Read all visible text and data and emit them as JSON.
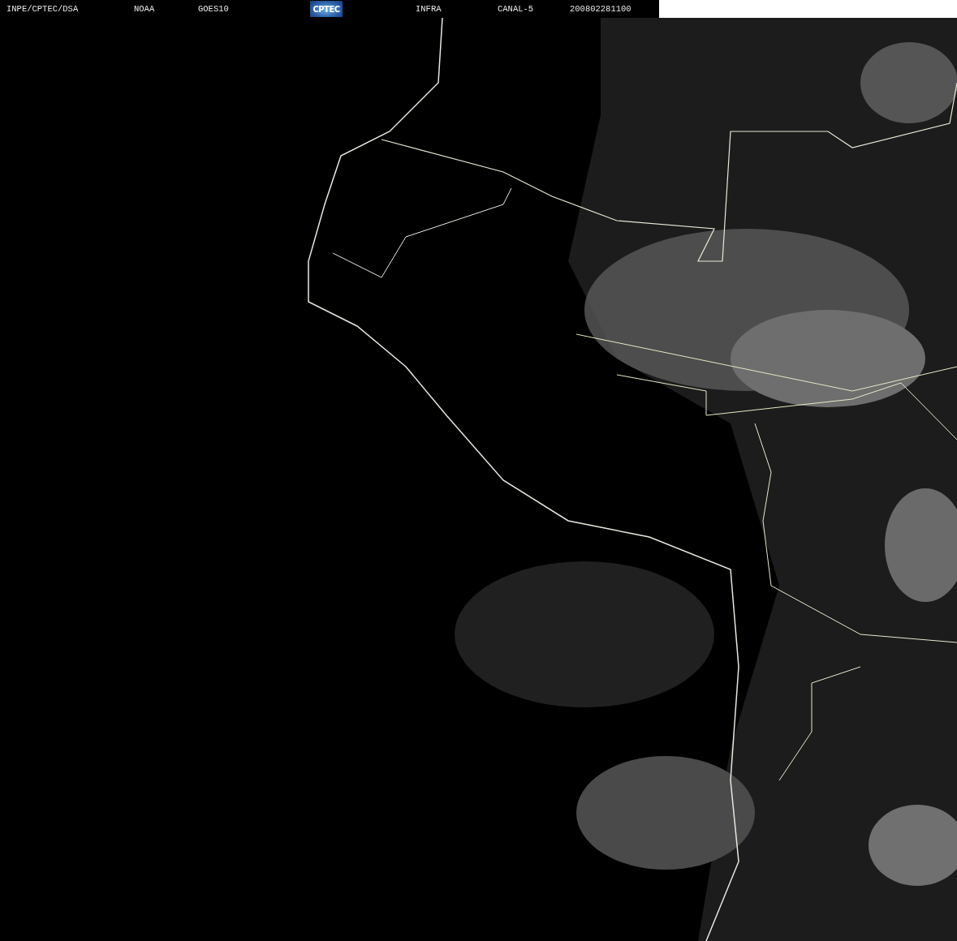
{
  "header": {
    "labels": [
      "INPE/CPTEC/DSA",
      "NOAA",
      "GOES10"
    ],
    "logo": "CPTEC",
    "product_labels": [
      "INFRA",
      "CANAL-5",
      "200802281100"
    ]
  }
}
